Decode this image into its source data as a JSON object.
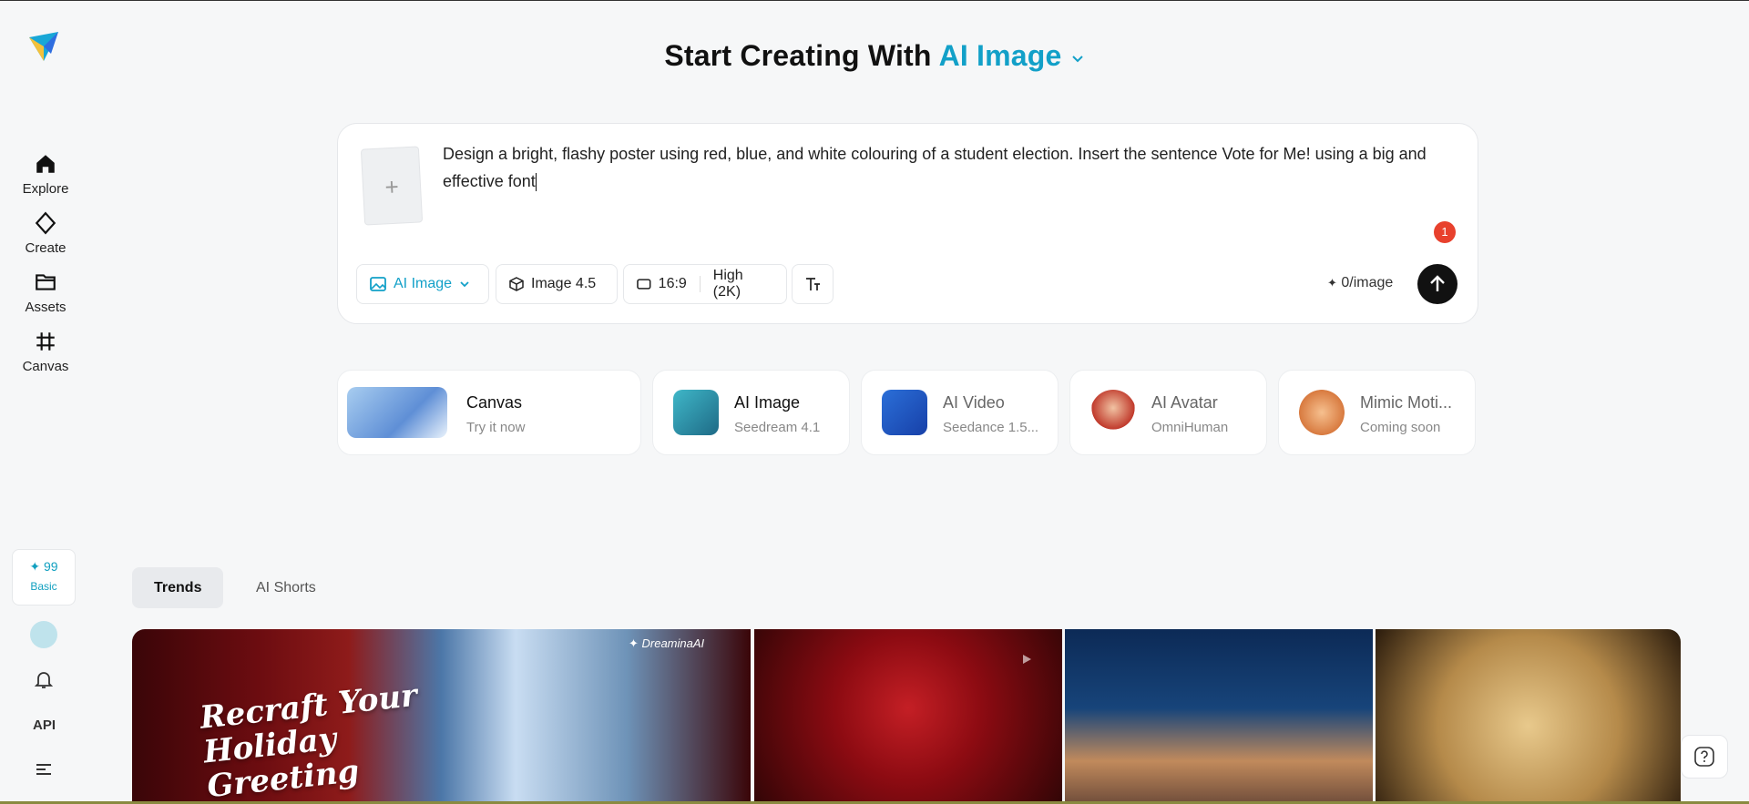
{
  "sidebar": {
    "items": [
      {
        "label": "Explore",
        "icon": "home-icon"
      },
      {
        "label": "Create",
        "icon": "diamond-icon"
      },
      {
        "label": "Assets",
        "icon": "folder-icon"
      },
      {
        "label": "Canvas",
        "icon": "crop-icon"
      }
    ],
    "credits": "✦ 99",
    "plan": "Basic",
    "api_label": "API"
  },
  "heading": {
    "prefix": "Start Creating With",
    "mode": "AI Image"
  },
  "prompt": {
    "text_line1": "Design a bright, flashy poster using red, blue, and white colouring of a student election. Insert the sentence Vote for Me! using a big and",
    "text_line2": "effective font",
    "badge_count": "1",
    "mode_label": "AI Image",
    "model_label": "Image 4.5",
    "ratio_label": "16:9",
    "quality_label": "High (2K)",
    "cost_label": "0/image"
  },
  "tools": [
    {
      "title": "Canvas",
      "subtitle": "Try it now"
    },
    {
      "title": "AI Image",
      "subtitle": "Seedream 4.1"
    },
    {
      "title": "AI Video",
      "subtitle": "Seedance 1.5..."
    },
    {
      "title": "AI Avatar",
      "subtitle": "OmniHuman"
    },
    {
      "title": "Mimic Moti...",
      "subtitle": "Coming soon"
    }
  ],
  "tabs": [
    "Trends",
    "AI Shorts"
  ],
  "gallery": {
    "item1_title": "Recraft Your Holiday Greeting",
    "item1_brand": "✦ DreaminaAI"
  },
  "colors": {
    "accent": "#12a0c8",
    "badge": "#e8412d"
  }
}
